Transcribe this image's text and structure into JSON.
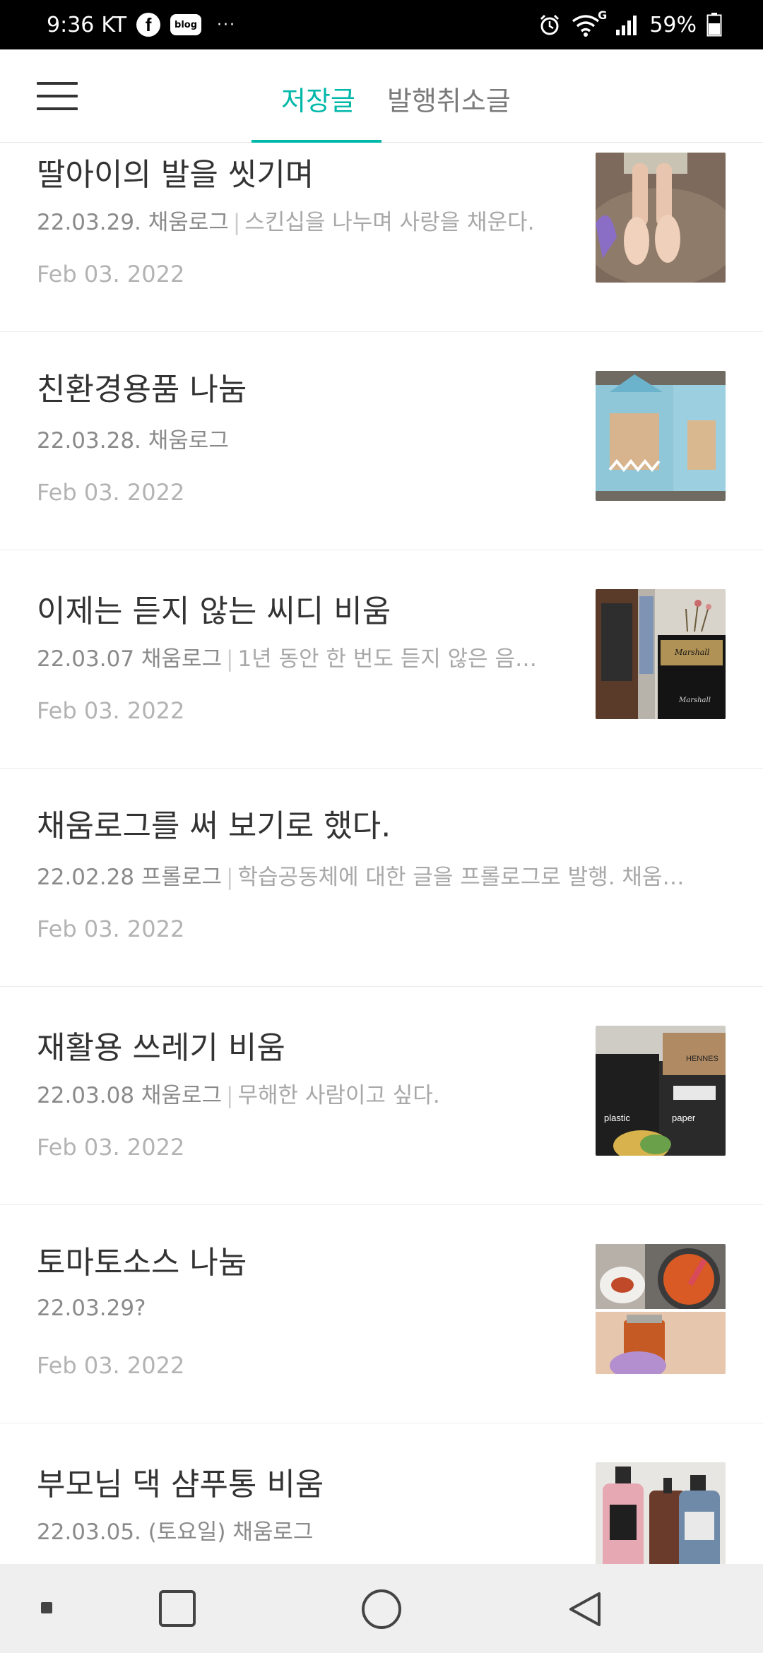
{
  "status_bar": {
    "time": "9:36",
    "carrier": "KT",
    "facebook_glyph": "f",
    "blog_label": "blog",
    "overflow": "···",
    "network_type": "G",
    "battery": "59%"
  },
  "header": {
    "tabs": [
      {
        "label": "저장글",
        "active": true
      },
      {
        "label": "발행취소글",
        "active": false
      }
    ],
    "accent_color": "#00b8a9"
  },
  "posts": [
    {
      "title": "딸아이의 발을 씻기며",
      "meta": "22.03.29. 채움로그",
      "desc": "스킨십을 나누며 사랑을 채운다.",
      "date": "Feb 03. 2022",
      "thumb": "child-feet-basin"
    },
    {
      "title": "친환경용품 나눔",
      "meta": "22.03.28. 채움로그",
      "desc": "",
      "date": "Feb 03. 2022",
      "thumb": "shark-packages"
    },
    {
      "title": "이제는 듣지 않는 씨디 비움",
      "meta": "22.03.07 채움로그",
      "desc": "1년 동안 한 번도 듣지 않은 음…",
      "date": "Feb 03. 2022",
      "thumb": "cd-shelf-amp"
    },
    {
      "title": "채움로그를 써 보기로 했다.",
      "meta": "22.02.28 프롤로그",
      "desc": "학습공동체에 대한 글을 프롤로그로 발행. 채움…",
      "date": "Feb 03. 2022",
      "thumb": ""
    },
    {
      "title": "재활용 쓰레기 비움",
      "meta": "22.03.08 채움로그",
      "desc": "무해한 사람이고 싶다.",
      "date": "Feb 03. 2022",
      "thumb": "recycling-boxes"
    },
    {
      "title": "토마토소스 나눔",
      "meta": "22.03.29?",
      "desc": "",
      "date": "Feb 03. 2022",
      "thumb": "tomato-sauce"
    },
    {
      "title": "부모님 댁 샴푸통 비움",
      "meta": "22.03.05. (토요일) 채움로그",
      "desc": "",
      "date": "",
      "thumb": "shampoo-bottles"
    }
  ],
  "thumb_texts": {
    "amp1": "Marshall",
    "amp2": "Marshall",
    "bag1": "plastic",
    "bag2": "paper",
    "box": "HENNES"
  },
  "icons": {
    "menu": "hamburger-menu-icon",
    "recents": "square-recents-icon",
    "home": "circle-home-icon",
    "back": "triangle-back-icon"
  }
}
